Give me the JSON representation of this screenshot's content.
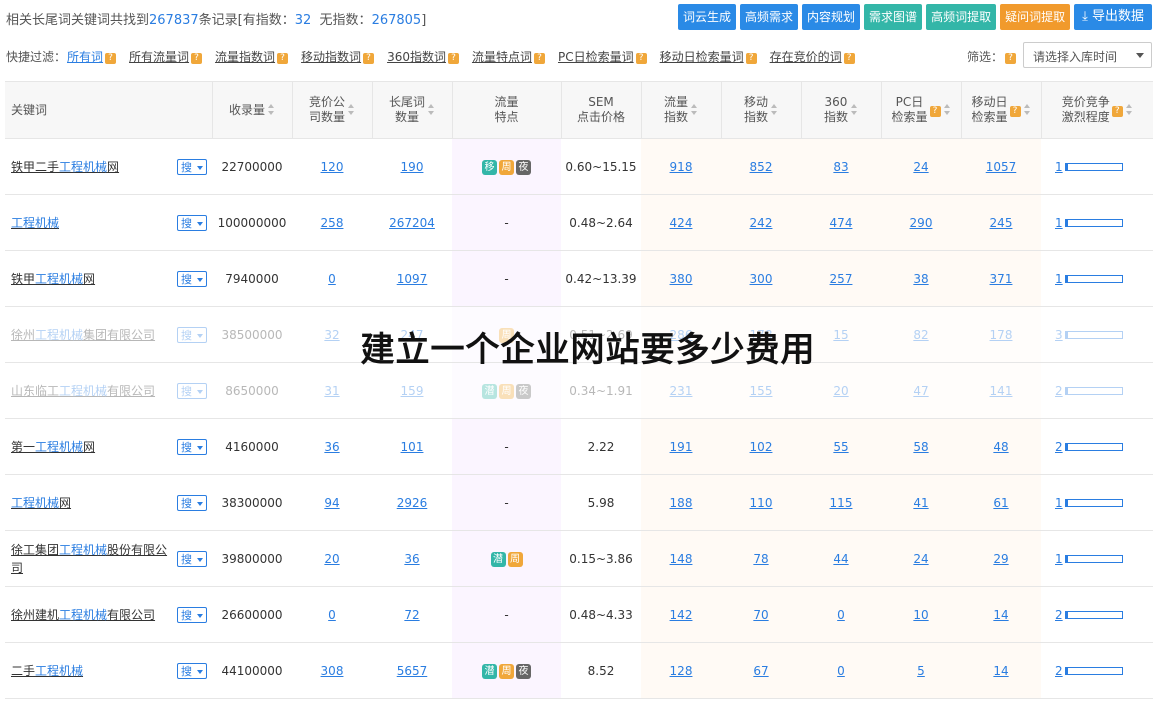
{
  "summary": {
    "prefix": "相关长尾词关键词共找到",
    "total": "267837",
    "mid": "条记录[有指数：",
    "indexed": "32",
    "mid2": "无指数：",
    "unindexed": "267805",
    "suffix": "]"
  },
  "toolbar": {
    "buttons": [
      "词云生成",
      "高频需求",
      "内容规划",
      "需求图谱",
      "高频词提取",
      "疑问词提取",
      "导出数据"
    ]
  },
  "quick_filter": {
    "label": "快捷过滤：",
    "items": [
      "所有词",
      "所有流量词",
      "流量指数词",
      "移动指数词",
      "360指数词",
      "流量特点词",
      "PC日检索量词",
      "移动日检索量词",
      "存在竞价的词"
    ]
  },
  "screen": {
    "label": "筛选：",
    "placeholder": "请选择入库时间"
  },
  "table": {
    "headers": {
      "keyword": "关键词",
      "collected": "收录量",
      "bid_l1": "竞价公",
      "bid_l2": "司数量",
      "long_l1": "长尾词",
      "long_l2": "数量",
      "traffic_l1": "流量",
      "traffic_l2": "特点",
      "sem_l1": "SEM",
      "sem_l2": "点击价格",
      "flow_l1": "流量",
      "flow_l2": "指数",
      "mobile_l1": "移动",
      "mobile_l2": "指数",
      "i360_l1": "360",
      "i360_l2": "指数",
      "pc_l1": "PC日",
      "pc_l2": "检索量",
      "mday_l1": "移动日",
      "mday_l2": "检索量",
      "comp_l1": "竞价竞争",
      "comp_l2": "激烈程度"
    },
    "search_label": "搜",
    "rows": [
      {
        "kw_pre": "铁甲二手",
        "kw_hl": "工程机械",
        "kw_post": "网",
        "collected": "22700000",
        "bid": "120",
        "long": "190",
        "tags": [
          "移",
          "周",
          "夜"
        ],
        "sem": "0.60~15.15",
        "flow": "918",
        "mobile": "852",
        "i360": "83",
        "pc": "24",
        "mday": "1057",
        "comp": "1",
        "comp_level": 0.05
      },
      {
        "kw_pre": "",
        "kw_hl": "工程机械",
        "kw_post": "",
        "collected": "100000000",
        "bid": "258",
        "long": "267204",
        "tags": [],
        "sem": "0.48~2.64",
        "flow": "424",
        "mobile": "242",
        "i360": "474",
        "pc": "290",
        "mday": "245",
        "comp": "1",
        "comp_level": 0.05
      },
      {
        "kw_pre": "铁甲",
        "kw_hl": "工程机械",
        "kw_post": "网",
        "collected": "7940000",
        "bid": "0",
        "long": "1097",
        "tags": [],
        "sem": "0.42~13.39",
        "flow": "380",
        "mobile": "300",
        "i360": "257",
        "pc": "38",
        "mday": "371",
        "comp": "1",
        "comp_level": 0.05
      },
      {
        "kw_pre": "徐州",
        "kw_hl": "工程机械",
        "kw_post": "集团有限公司",
        "collected": "38500000",
        "bid": "32",
        "long": "247",
        "tags": [
          "周"
        ],
        "sem": "0.51~2.69",
        "flow": "286",
        "mobile": "178",
        "i360": "15",
        "pc": "82",
        "mday": "178",
        "comp": "3",
        "comp_level": 0.05
      },
      {
        "kw_pre": "山东临工",
        "kw_hl": "工程机械",
        "kw_post": "有限公司",
        "collected": "8650000",
        "bid": "31",
        "long": "159",
        "tags": [
          "潜",
          "周",
          "夜"
        ],
        "sem": "0.34~1.91",
        "flow": "231",
        "mobile": "155",
        "i360": "20",
        "pc": "47",
        "mday": "141",
        "comp": "2",
        "comp_level": 0.05
      },
      {
        "kw_pre": "第一",
        "kw_hl": "工程机械",
        "kw_post": "网",
        "collected": "4160000",
        "bid": "36",
        "long": "101",
        "tags": [],
        "sem": "2.22",
        "flow": "191",
        "mobile": "102",
        "i360": "55",
        "pc": "58",
        "mday": "48",
        "comp": "2",
        "comp_level": 0.05
      },
      {
        "kw_pre": "",
        "kw_hl": "工程机械",
        "kw_post": "网",
        "collected": "38300000",
        "bid": "94",
        "long": "2926",
        "tags": [],
        "sem": "5.98",
        "flow": "188",
        "mobile": "110",
        "i360": "115",
        "pc": "41",
        "mday": "61",
        "comp": "1",
        "comp_level": 0.05
      },
      {
        "kw_pre": "徐工集团",
        "kw_hl": "工程机械",
        "kw_post": "股份有限公司",
        "collected": "39800000",
        "bid": "20",
        "long": "36",
        "tags": [
          "潜",
          "周"
        ],
        "sem": "0.15~3.86",
        "flow": "148",
        "mobile": "78",
        "i360": "44",
        "pc": "24",
        "mday": "29",
        "comp": "1",
        "comp_level": 0.05
      },
      {
        "kw_pre": "徐州建机",
        "kw_hl": "工程机械",
        "kw_post": "有限公司",
        "collected": "26600000",
        "bid": "0",
        "long": "72",
        "tags": [],
        "sem": "0.48~4.33",
        "flow": "142",
        "mobile": "70",
        "i360": "0",
        "pc": "10",
        "mday": "14",
        "comp": "2",
        "comp_level": 0.05
      },
      {
        "kw_pre": "二手",
        "kw_hl": "工程机械",
        "kw_post": "",
        "collected": "44100000",
        "bid": "308",
        "long": "5657",
        "tags": [
          "潜",
          "周",
          "夜"
        ],
        "sem": "8.52",
        "flow": "128",
        "mobile": "67",
        "i360": "0",
        "pc": "5",
        "mday": "14",
        "comp": "2",
        "comp_level": 0.05
      }
    ]
  },
  "overlay_title": "建立一个企业网站要多少费用",
  "colors": {
    "accent": "#2a7de1",
    "teal": "#33b6a8",
    "orange": "#f19a2c"
  }
}
